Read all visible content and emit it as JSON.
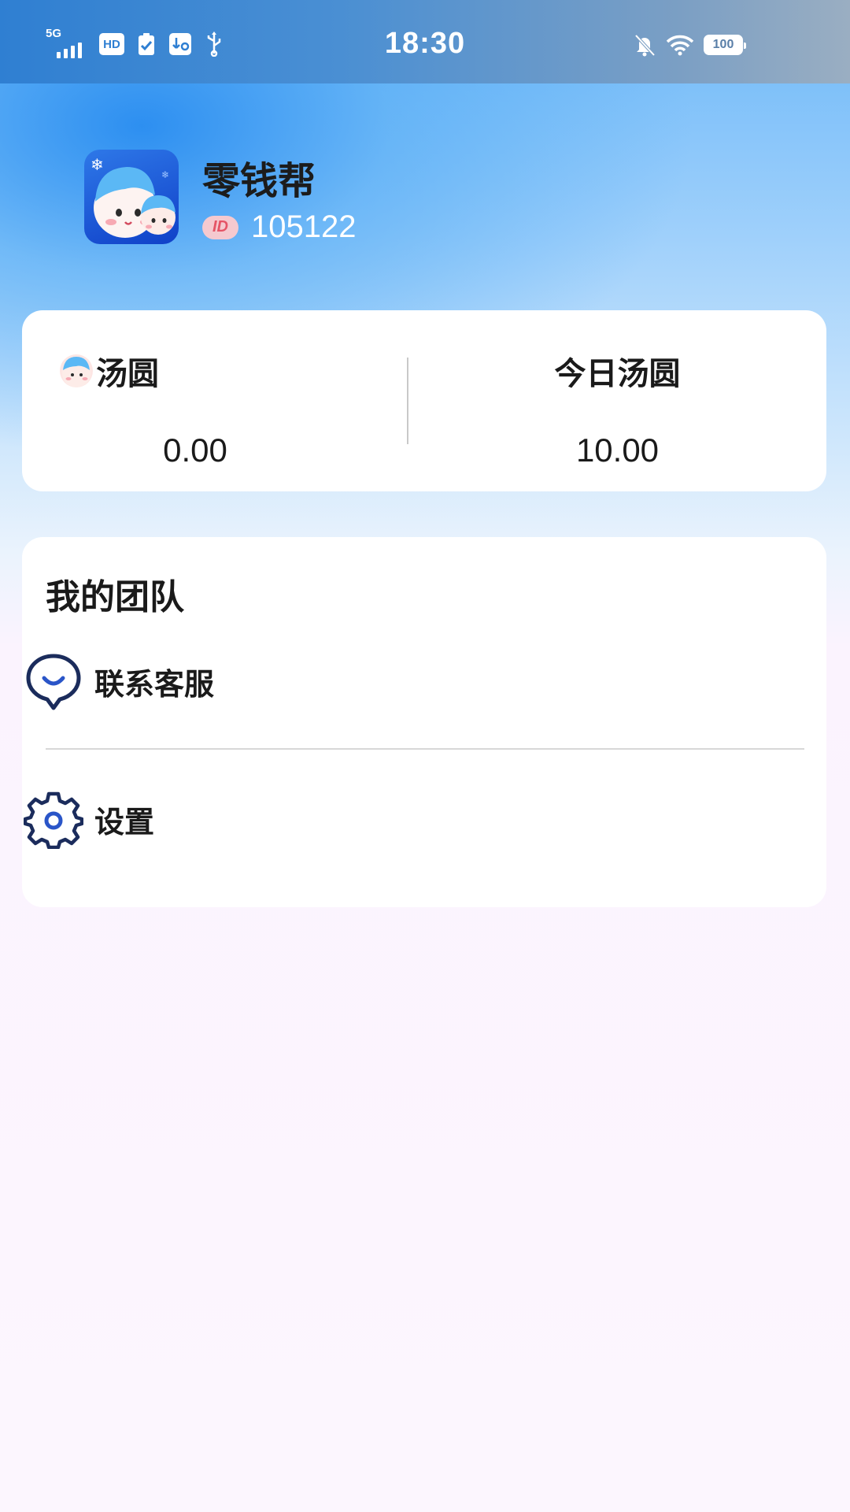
{
  "status_bar": {
    "network": "5G",
    "hd_label": "HD",
    "time": "18:30",
    "battery": "100"
  },
  "profile": {
    "app_name": "零钱帮",
    "id_badge": "ID",
    "id_value": "105122"
  },
  "balance": {
    "left_label": "汤圆",
    "left_value": "0.00",
    "right_label": "今日汤圆",
    "right_value": "10.00"
  },
  "team": {
    "title": "我的团队",
    "items": [
      {
        "label": "联系客服",
        "icon": "chat-bubble-icon"
      },
      {
        "label": "设置",
        "icon": "gear-icon"
      }
    ]
  },
  "colors": {
    "accent_blue": "#2f7fd2",
    "icon_navy": "#1b2c5c",
    "id_badge_bg": "#f5c9cf",
    "id_badge_text": "#e55466"
  }
}
